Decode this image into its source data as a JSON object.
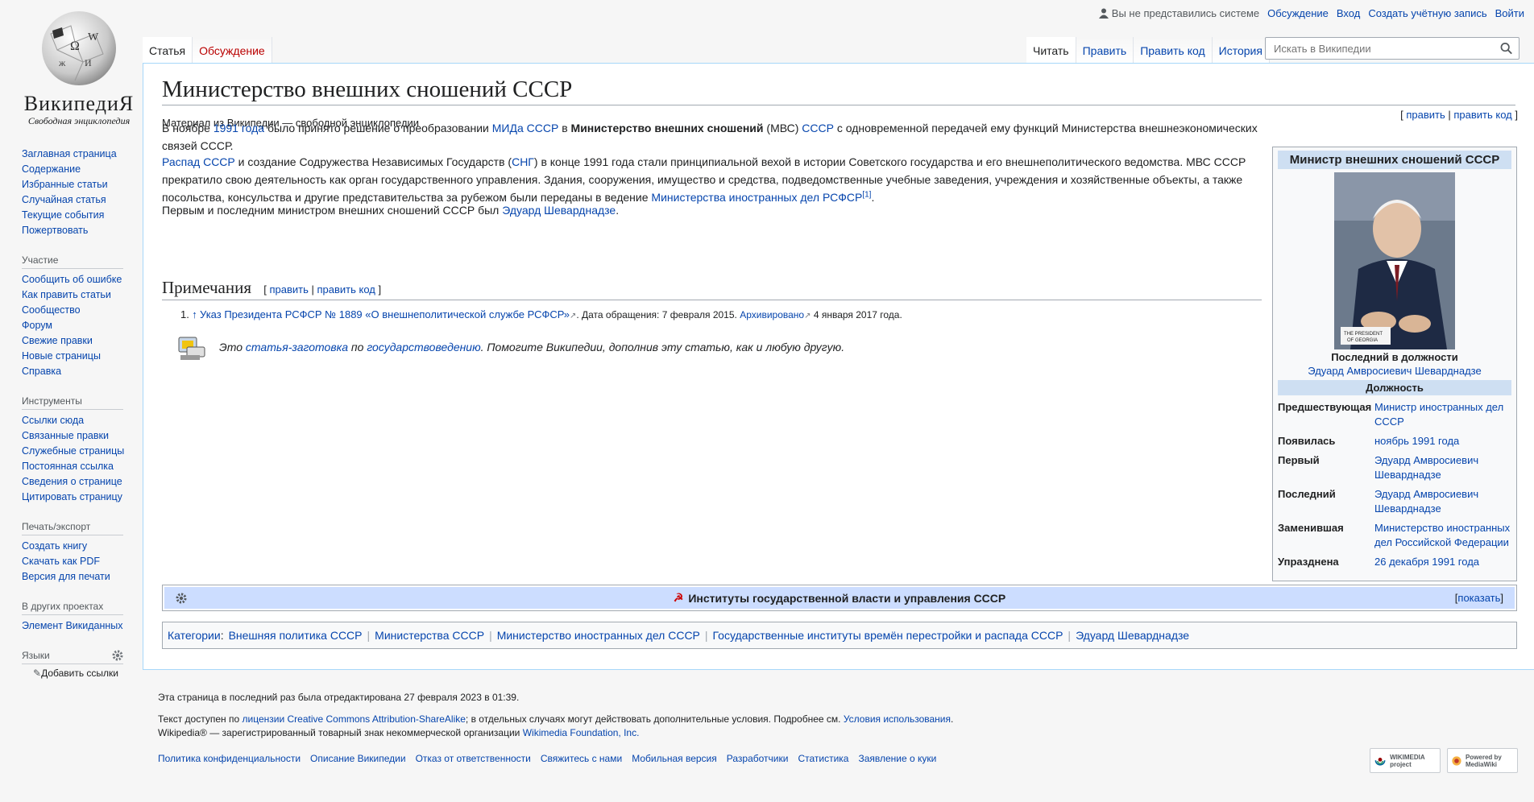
{
  "personal": {
    "anon": "Вы не представились системе",
    "talk": "Обсуждение",
    "login": "Вход",
    "create_account": "Создать учётную запись",
    "logout": "Войти"
  },
  "logo": {
    "wordmark": "ВикипедиЯ",
    "tagline": "Свободная энциклопедия"
  },
  "tabs": {
    "article": "Статья",
    "discussion": "Обсуждение",
    "read": "Читать",
    "edit": "Править",
    "edit_source": "Править код",
    "history": "История"
  },
  "search": {
    "placeholder": "Искать в Википедии"
  },
  "sidebar": {
    "navigation": [
      "Заглавная страница",
      "Содержание",
      "Избранные статьи",
      "Случайная статья",
      "Текущие события",
      "Пожертвовать"
    ],
    "participation_title": "Участие",
    "participation": [
      "Сообщить об ошибке",
      "Как править статьи",
      "Сообщество",
      "Форум",
      "Свежие правки",
      "Новые страницы",
      "Справка"
    ],
    "tools_title": "Инструменты",
    "tools": [
      "Ссылки сюда",
      "Связанные правки",
      "Служебные страницы",
      "Постоянная ссылка",
      "Сведения о странице",
      "Цитировать страницу"
    ],
    "print_title": "Печать/экспорт",
    "print": [
      "Создать книгу",
      "Скачать как PDF",
      "Версия для печати"
    ],
    "other_title": "В других проектах",
    "other": [
      "Элемент Викиданных"
    ],
    "languages_title": "Языки",
    "add_links": "Добавить ссылки"
  },
  "article": {
    "title": "Министерство внешних сношений СССР",
    "site_sub": "Материал из Википедии — свободной энциклопедии",
    "top_edit": {
      "edit": "править",
      "edit_source": "править код"
    },
    "p1": {
      "a": "В ноябре ",
      "link1": "1991 года",
      "b": " было принято решение о преобразовании ",
      "link2": "МИДа СССР",
      "c": " в ",
      "bold": "Министерство внешних сношений",
      "d": " (МВС) ",
      "link3": "СССР",
      "e": " с одновременной передачей ему функций Министерства внешнеэкономических связей СССР."
    },
    "p2": {
      "link1": "Распад СССР",
      "a": " и создание Содружества Независимых Государств (",
      "link2": "СНГ",
      "b": ") в конце 1991 года стали принципиальной вехой в истории Советского государства и его внешнеполитического ведомства. МВС СССР прекратило свою деятельность как орган государственного управления. Здания, сооружения, имущество и средства, подведомственные учебные заведения, учреждения и хозяйственные объекты, а также посольства, консульства и другие представительства за рубежом были переданы в ведение ",
      "link3": "Министерства иностранных дел РСФСР",
      "ref": "[1]",
      "c": "."
    },
    "p3": {
      "a": "Первым и последним министром внешних сношений СССР был ",
      "link1": "Эдуард Шеварднадзе",
      "b": "."
    },
    "notes_heading": "Примечания",
    "notes_edit": {
      "edit": "править",
      "edit_source": "править код"
    },
    "ref1": {
      "num": "1.",
      "arrow": "↑",
      "link": "Указ Президента РСФСР № 1889 «О внешнеполитической службе РСФСР»",
      "accessed": ". Дата обращения: 7 февраля 2015.",
      "archived": "Архивировано",
      "archived_date": " 4 января 2017 года."
    },
    "stub": {
      "a": "Это ",
      "link1": "статья-заготовка",
      "b": " по ",
      "link2": "государствоведению",
      "c": ". Помогите Википедии, дополнив эту статью, как и любую другую."
    }
  },
  "infobox": {
    "title": "Министр внешних сношений СССР",
    "photo_plate": "THE PRESIDENT OF GEORGIA",
    "caption": "Последний в должности",
    "person": "Эдуард Амвросиевич Шеварднадзе",
    "section": "Должность",
    "rows": [
      {
        "key": "Предшествующая",
        "value": "Министр иностранных дел СССР"
      },
      {
        "key": "Появилась",
        "value": "ноябрь 1991 года"
      },
      {
        "key": "Первый",
        "value": "Эдуард Амвросиевич Шеварднадзе"
      },
      {
        "key": "Последний",
        "value": "Эдуард Амвросиевич Шеварднадзе"
      },
      {
        "key": "Заменившая",
        "value": "Министерство иностранных дел Российской Федерации"
      },
      {
        "key": "Упразднена",
        "value": "26 декабря 1991 года"
      }
    ]
  },
  "navbox": {
    "symbol": "☭",
    "title": "Институты государственной власти и управления СССР",
    "show": "показать"
  },
  "categories": {
    "label": "Категории",
    "items": [
      "Внешняя политика СССР",
      "Министерства СССР",
      "Министерство иностранных дел СССР",
      "Государственные институты времён перестройки и распада СССР",
      "Эдуард Шеварднадзе"
    ]
  },
  "footer": {
    "last_mod": "Эта страница в последний раз была отредактирована 27 февраля 2023 в 01:39.",
    "license_a": "Текст доступен по ",
    "license_link": "лицензии Creative Commons Attribution-ShareAlike",
    "license_b": "; в отдельных случаях могут действовать дополнительные условия. Подробнее см. ",
    "terms_link": "Условия использования",
    "license_c": ".",
    "trademark_a": "Wikipedia® — зарегистрированный товарный знак некоммерческой организации ",
    "trademark_link": "Wikimedia Foundation, Inc.",
    "places": [
      "Политика конфиденциальности",
      "Описание Википедии",
      "Отказ от ответственности",
      "Свяжитесь с нами",
      "Мобильная версия",
      "Разработчики",
      "Статистика",
      "Заявление о куки"
    ],
    "badge_wikimedia": "WIKIMEDIA project",
    "badge_mediawiki": "Powered by MediaWiki"
  }
}
